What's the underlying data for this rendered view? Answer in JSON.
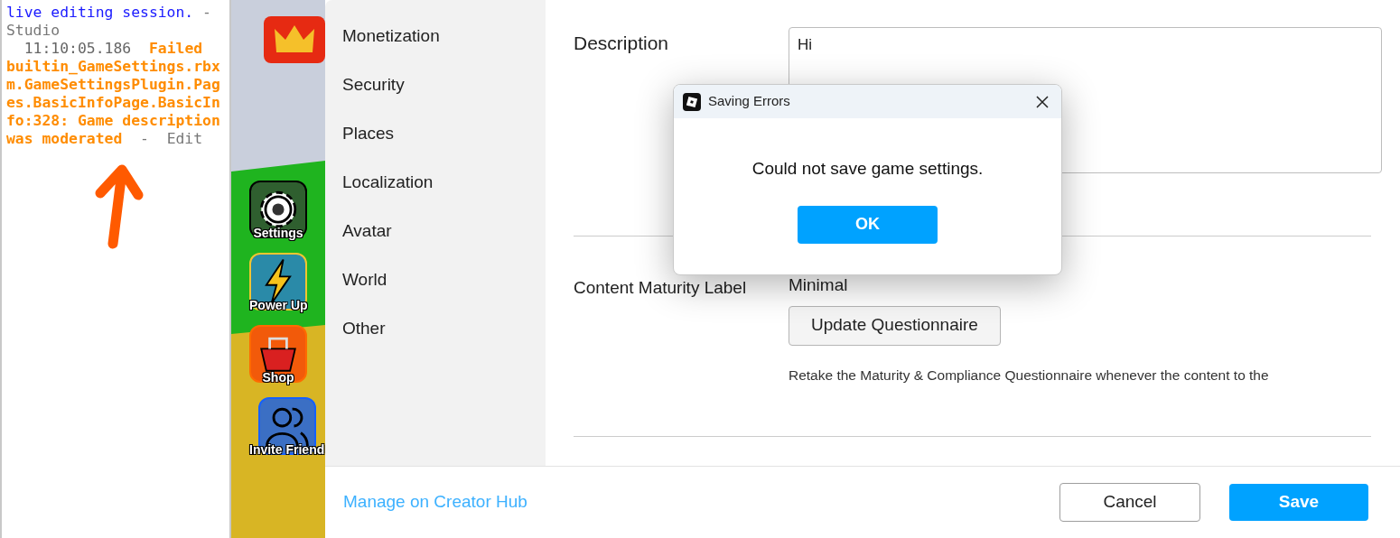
{
  "output_log": {
    "lines": [
      {
        "segments": [
          {
            "text": "live editing session.",
            "kind": "message"
          },
          {
            "text": " -  Studio",
            "kind": "source"
          }
        ]
      },
      {
        "segments": [
          {
            "text": "  11:10:05.186  ",
            "kind": "time"
          },
          {
            "text": "Failed builtin_GameSettings.rbxm.GameSettingsPlugin.Pages.BasicInfoPage.BasicInfo:328: Game description was moderated",
            "kind": "error"
          },
          {
            "text": "  -  Edit",
            "kind": "source"
          }
        ]
      }
    ]
  },
  "game_view": {
    "buttons": [
      {
        "label": "Settings",
        "kind": "gear"
      },
      {
        "label": "Power Up",
        "kind": "bolt"
      },
      {
        "label": "Shop",
        "kind": "basket"
      },
      {
        "label": "Invite Friend",
        "kind": "people"
      }
    ]
  },
  "settings": {
    "nav": [
      {
        "label": "Monetization",
        "selected": false
      },
      {
        "label": "Security",
        "selected": false
      },
      {
        "label": "Places",
        "selected": false
      },
      {
        "label": "Localization",
        "selected": false
      },
      {
        "label": "Avatar",
        "selected": false
      },
      {
        "label": "World",
        "selected": false
      },
      {
        "label": "Other",
        "selected": false
      }
    ],
    "description": {
      "label": "Description",
      "value": "Hi"
    },
    "maturity": {
      "label": "Content Maturity Label",
      "value": "Minimal",
      "button": "Update Questionnaire",
      "help": "Retake the Maturity & Compliance Questionnaire whenever the content to the"
    },
    "footer": {
      "link": "Manage on Creator Hub",
      "cancel": "Cancel",
      "save": "Save"
    }
  },
  "dialog": {
    "title": "Saving Errors",
    "message": "Could not save game settings.",
    "ok": "OK"
  }
}
